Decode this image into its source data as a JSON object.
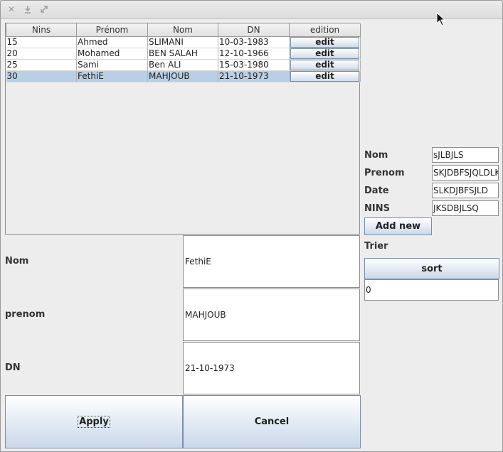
{
  "table": {
    "columns": [
      "Nins",
      "Prénom",
      "Nom",
      "DN",
      "edition"
    ],
    "rows": [
      {
        "nins": "15",
        "prenom": "Ahmed",
        "nom": "SLIMANI",
        "dn": "10-03-1983",
        "action": "edit"
      },
      {
        "nins": "20",
        "prenom": "Mohamed",
        "nom": "BEN SALAH",
        "dn": "12-10-1966",
        "action": "edit"
      },
      {
        "nins": "25",
        "prenom": "Sami",
        "nom": "Ben ALI",
        "dn": "15-03-1980",
        "action": "edit"
      },
      {
        "nins": "30",
        "prenom": "FethiE",
        "nom": "MAHJOUB",
        "dn": "21-10-1973",
        "action": "edit",
        "selected": true
      }
    ]
  },
  "form": {
    "nom_label": "Nom",
    "nom_value": "FethiE",
    "prenom_label": "prenom",
    "prenom_value": "MAHJOUB",
    "dn_label": "DN",
    "dn_value": "21-10-1973",
    "apply_label": "Apply",
    "cancel_label": "Cancel"
  },
  "side": {
    "nom_label": "Nom",
    "nom_value": "sJLBJLS",
    "prenom_label": "Prenom",
    "prenom_value": "SKJDBFSJQLDLKJ",
    "date_label": "Date",
    "date_value": "SLKDJBFSJLD",
    "nins_label": "NINS",
    "nins_value": "JKSDBJLSQ",
    "add_label": "Add new",
    "trier_label": "Trier",
    "sort_label": "sort",
    "sort_value": "0"
  },
  "icons": {
    "close": "close-icon",
    "minimize": "minimize-icon",
    "maximize": "maximize-icon"
  },
  "colors": {
    "selected_row": "#b8cfe5",
    "button_gradient_bottom": "#c9d8ea"
  }
}
